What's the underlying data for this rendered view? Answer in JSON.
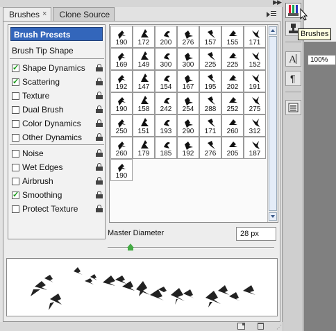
{
  "tabs": [
    {
      "label": "Brushes",
      "close": "×"
    },
    {
      "label": "Clone Source"
    }
  ],
  "options": {
    "presets_label": "Brush Presets",
    "tip_shape_label": "Brush Tip Shape",
    "items": [
      {
        "label": "Shape Dynamics",
        "checked": true,
        "locked": true
      },
      {
        "label": "Scattering",
        "checked": true,
        "locked": true
      },
      {
        "label": "Texture",
        "checked": false,
        "locked": true
      },
      {
        "label": "Dual Brush",
        "checked": false,
        "locked": true
      },
      {
        "label": "Color Dynamics",
        "checked": false,
        "locked": true
      },
      {
        "label": "Other Dynamics",
        "checked": false,
        "locked": true
      },
      {
        "label": "Noise",
        "checked": false,
        "locked": true
      },
      {
        "label": "Wet Edges",
        "checked": false,
        "locked": true
      },
      {
        "label": "Airbrush",
        "checked": false,
        "locked": true
      },
      {
        "label": "Smoothing",
        "checked": true,
        "locked": true
      },
      {
        "label": "Protect Texture",
        "checked": false,
        "locked": true
      }
    ]
  },
  "brushes": [
    "190",
    "172",
    "200",
    "276",
    "157",
    "155",
    "171",
    "169",
    "149",
    "300",
    "300",
    "225",
    "225",
    "152",
    "192",
    "147",
    "154",
    "167",
    "195",
    "202",
    "191",
    "190",
    "158",
    "242",
    "254",
    "288",
    "252",
    "275",
    "250",
    "151",
    "193",
    "290",
    "171",
    "260",
    "312",
    "260",
    "179",
    "185",
    "192",
    "276",
    "205",
    "187",
    "190"
  ],
  "master_diameter": {
    "label": "Master Diameter",
    "value": "28 px"
  },
  "tooltip": "Brushes",
  "zoom": "100%",
  "colors": {
    "selection": "#3366bb",
    "check": "#119911",
    "slider": "#44aa44"
  }
}
